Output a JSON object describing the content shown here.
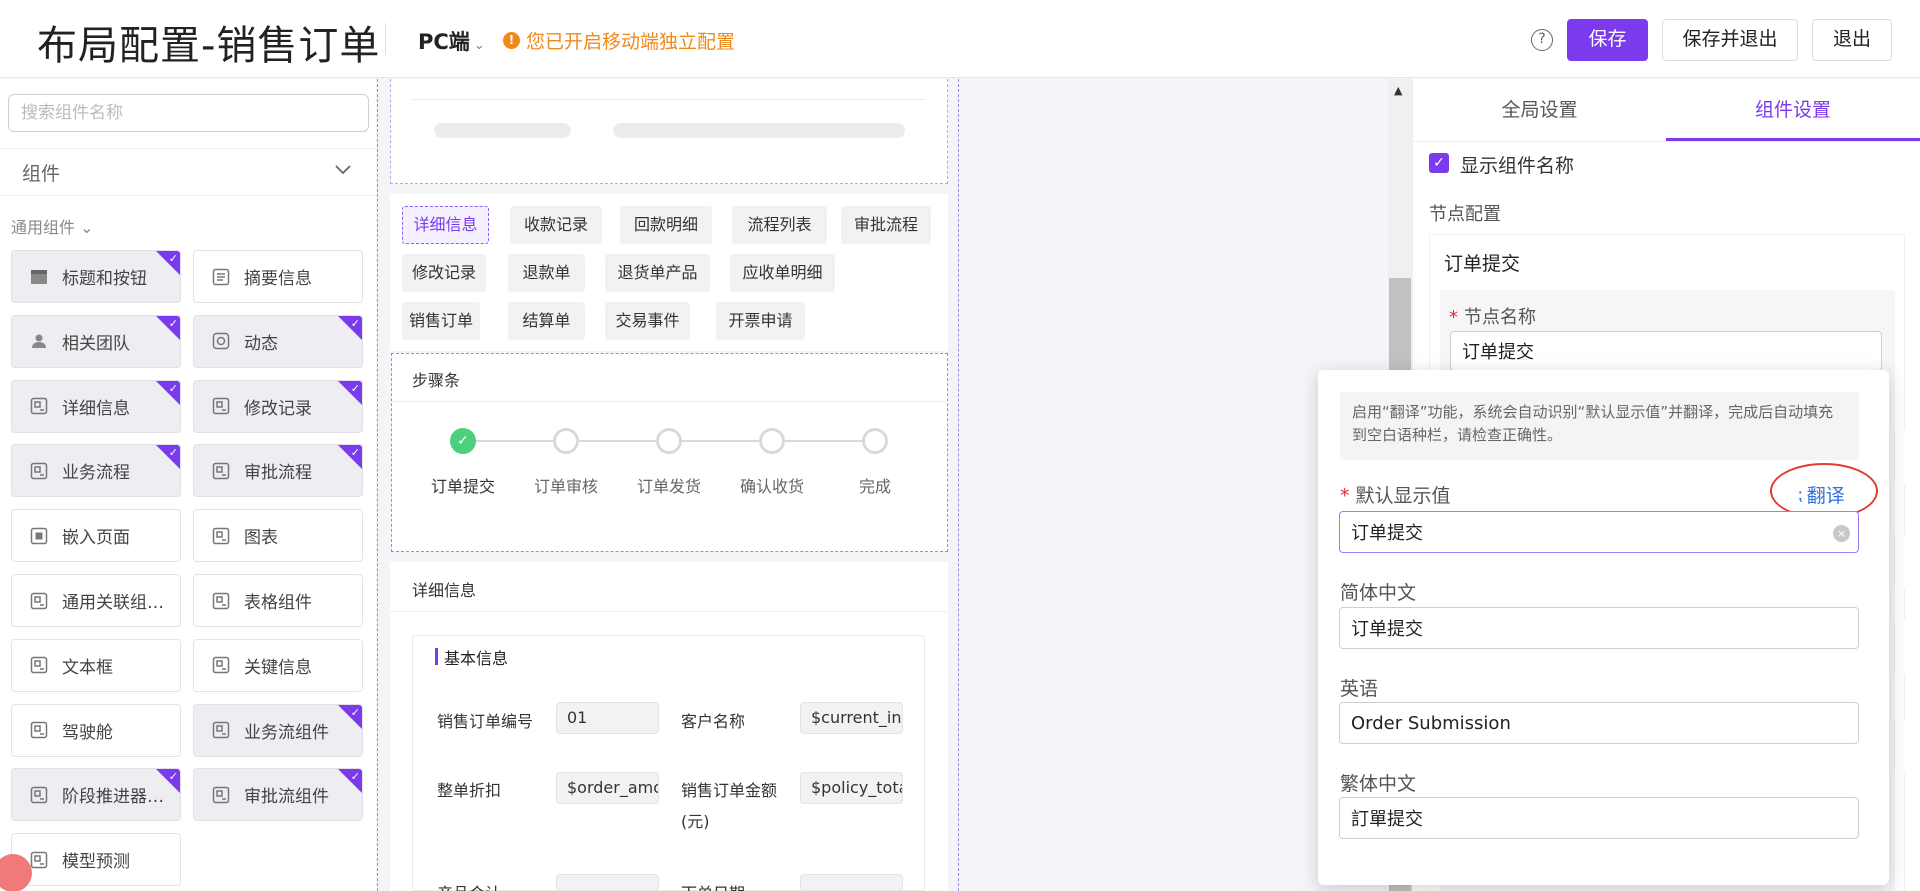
{
  "header": {
    "title": "布局配置-销售订单",
    "platform": "PC端",
    "mobile_warning": "您已开启移动端独立配置",
    "save": "保存",
    "save_and_exit": "保存并退出",
    "exit": "退出"
  },
  "left_panel": {
    "search_placeholder": "搜索组件名称",
    "section_title": "组件",
    "group_title": "通用组件",
    "components": [
      {
        "label": "标题和按钮",
        "selected": true,
        "icon": "header-icon"
      },
      {
        "label": "摘要信息",
        "selected": false,
        "icon": "list-icon"
      },
      {
        "label": "相关团队",
        "selected": true,
        "icon": "user-icon"
      },
      {
        "label": "动态",
        "selected": true,
        "icon": "activity-icon"
      },
      {
        "label": "详细信息",
        "selected": true,
        "icon": "component-icon"
      },
      {
        "label": "修改记录",
        "selected": true,
        "icon": "component-icon"
      },
      {
        "label": "业务流程",
        "selected": true,
        "icon": "component-icon"
      },
      {
        "label": "审批流程",
        "selected": true,
        "icon": "component-icon"
      },
      {
        "label": "嵌入页面",
        "selected": false,
        "icon": "embed-icon"
      },
      {
        "label": "图表",
        "selected": false,
        "icon": "component-icon"
      },
      {
        "label": "通用关联组…",
        "selected": false,
        "icon": "component-icon"
      },
      {
        "label": "表格组件",
        "selected": false,
        "icon": "component-icon"
      },
      {
        "label": "文本框",
        "selected": false,
        "icon": "component-icon"
      },
      {
        "label": "关键信息",
        "selected": false,
        "icon": "component-icon"
      },
      {
        "label": "驾驶舱",
        "selected": false,
        "icon": "component-icon"
      },
      {
        "label": "业务流组件",
        "selected": true,
        "icon": "component-icon"
      },
      {
        "label": "阶段推进器…",
        "selected": true,
        "icon": "component-icon"
      },
      {
        "label": "审批流组件",
        "selected": true,
        "icon": "component-icon"
      },
      {
        "label": "模型预测",
        "selected": false,
        "icon": "component-icon"
      }
    ]
  },
  "canvas": {
    "tabs": [
      {
        "label": "详细信息",
        "active": true
      },
      {
        "label": "收款记录"
      },
      {
        "label": "回款明细"
      },
      {
        "label": "流程列表"
      },
      {
        "label": "审批流程"
      },
      {
        "label": "修改记录"
      },
      {
        "label": "退款单"
      },
      {
        "label": "退货单产品"
      },
      {
        "label": "应收单明细"
      },
      {
        "label": "销售订单"
      },
      {
        "label": "结算单"
      },
      {
        "label": "交易事件"
      },
      {
        "label": "开票申请"
      }
    ],
    "steps_title": "步骤条",
    "steps": [
      {
        "label": "订单提交",
        "done": true
      },
      {
        "label": "订单审核",
        "done": false
      },
      {
        "label": "订单发货",
        "done": false
      },
      {
        "label": "确认收货",
        "done": false
      },
      {
        "label": "完成",
        "done": false
      }
    ],
    "detail_title": "详细信息",
    "basic_title": "基本信息",
    "fields": [
      {
        "label": "销售订单编号",
        "value": "01"
      },
      {
        "label": "客户名称",
        "value": "$current_inte"
      },
      {
        "label": "整单折扣",
        "value": "$order_amou"
      },
      {
        "label": "销售订单金额",
        "label2": "(元)",
        "value": "$policy_total"
      },
      {
        "label": "产品合计",
        "value": ""
      },
      {
        "label": "下单日期",
        "value": ""
      }
    ]
  },
  "right_panel": {
    "tab_global": "全局设置",
    "tab_component": "组件设置",
    "show_name_label": "显示组件名称",
    "show_name_checked": true,
    "node_config": "节点配置",
    "node_title": "订单提交",
    "node_name_label": "节点名称",
    "node_name_value": "订单提交"
  },
  "translate_popup": {
    "tip": "启用“翻译”功能，系统会自动识别“默认显示值”并翻译，完成后自动填充到空白语种栏，请检查正确性。",
    "default_label": "默认显示值",
    "default_value": "订单提交",
    "translate_button": "翻译",
    "langs": [
      {
        "label": "简体中文",
        "value": "订单提交"
      },
      {
        "label": "英语",
        "value": "Order Submission"
      },
      {
        "label": "繁体中文",
        "value": "訂單提交"
      }
    ]
  },
  "colors": {
    "accent": "#7c3aed",
    "warning": "#f0891c",
    "success": "#4cd07d",
    "link": "#2f6fe0",
    "annotation_red": "#e53935"
  }
}
